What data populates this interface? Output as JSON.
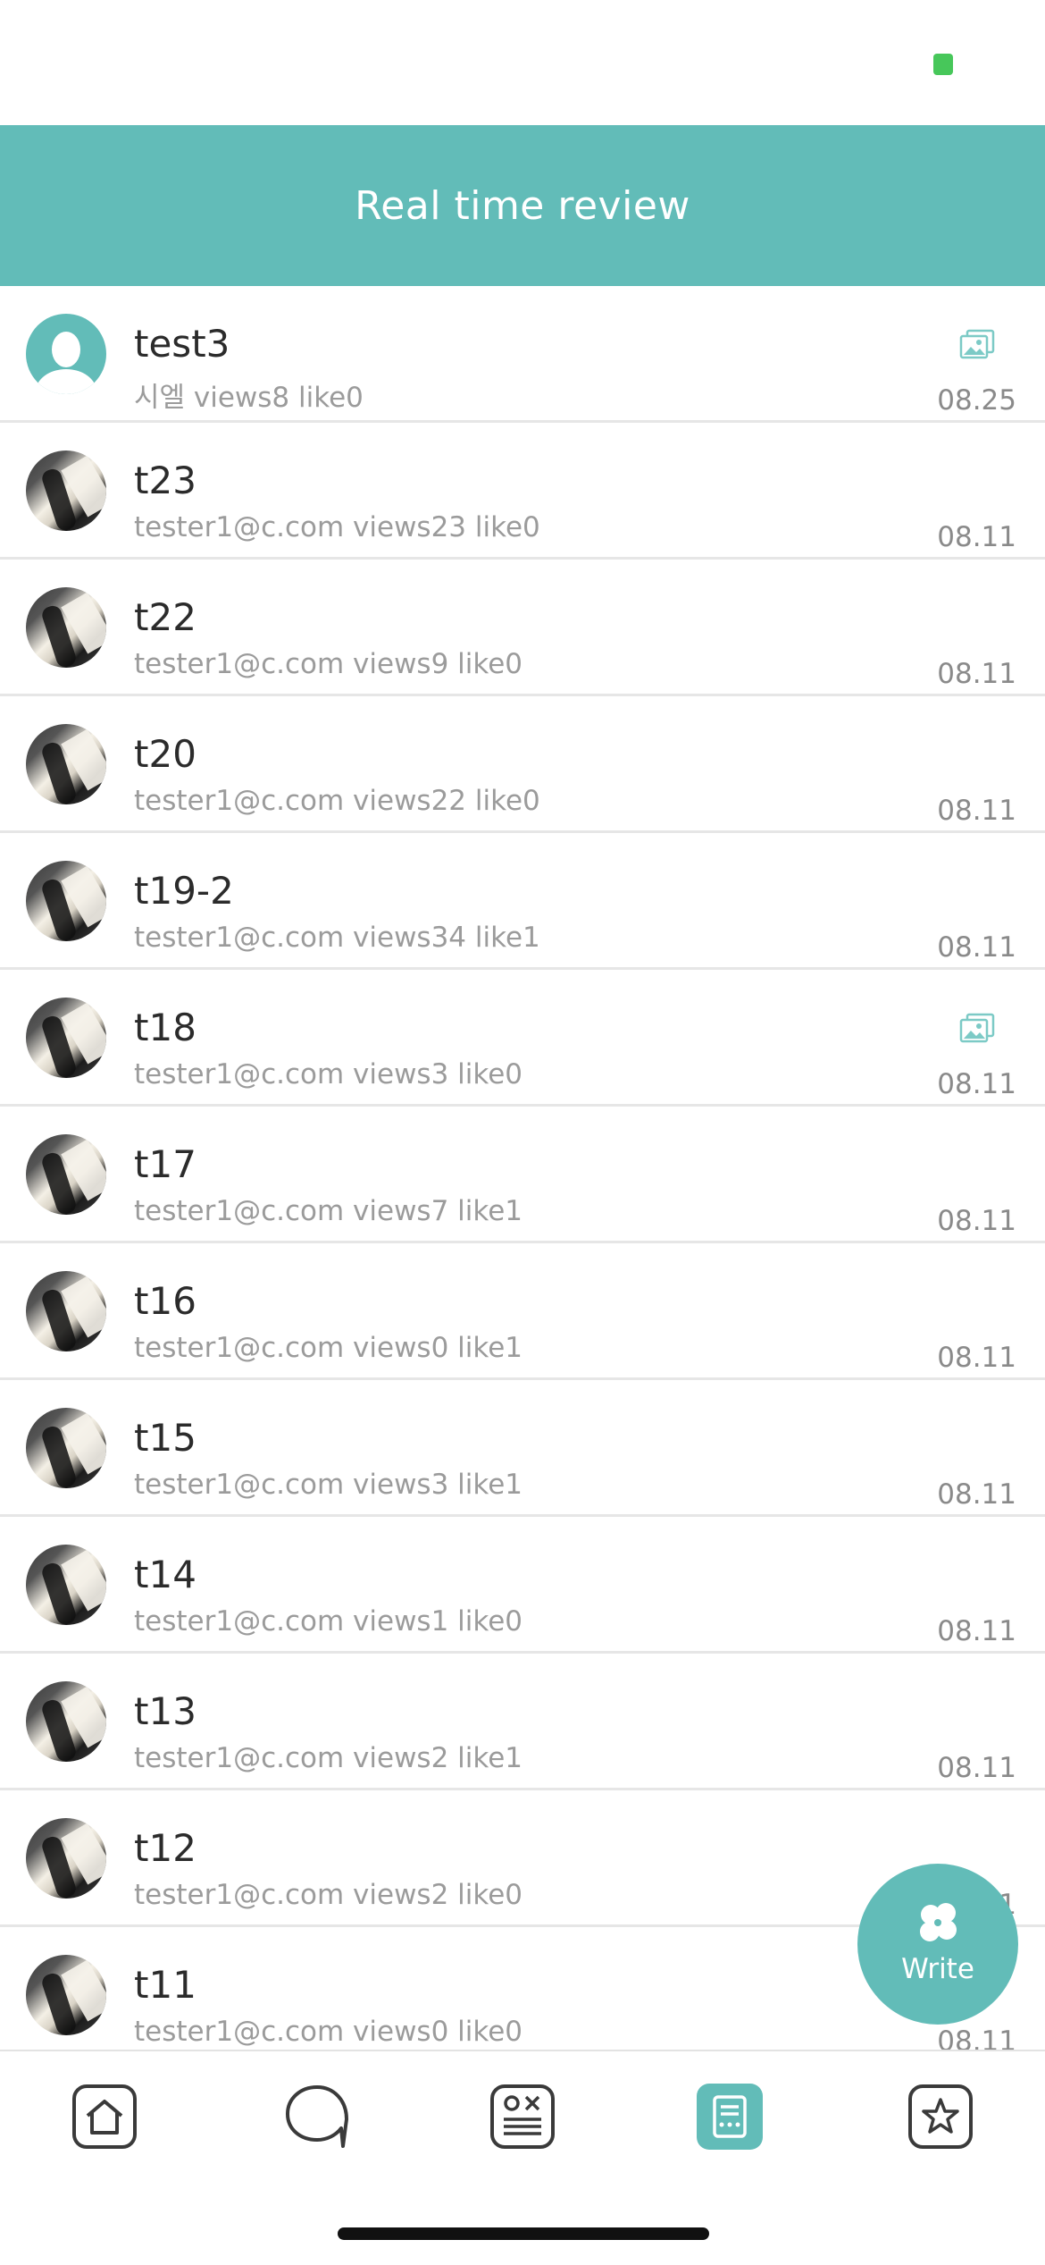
{
  "header": {
    "title": "Real time review"
  },
  "reviews": [
    {
      "title": "test3",
      "meta": "시엘 views8 like0",
      "date": "08.25",
      "avatar": "default-avatar",
      "has_image": true
    },
    {
      "title": "t23",
      "meta": "tester1@c.com views23 like0",
      "date": "08.11",
      "avatar": "photo-avatar",
      "has_image": false
    },
    {
      "title": "t22",
      "meta": "tester1@c.com views9 like0",
      "date": "08.11",
      "avatar": "photo-avatar",
      "has_image": false
    },
    {
      "title": "t20",
      "meta": "tester1@c.com views22 like0",
      "date": "08.11",
      "avatar": "photo-avatar",
      "has_image": false
    },
    {
      "title": "t19-2",
      "meta": "tester1@c.com views34 like1",
      "date": "08.11",
      "avatar": "photo-avatar",
      "has_image": false
    },
    {
      "title": "t18",
      "meta": "tester1@c.com views3 like0",
      "date": "08.11",
      "avatar": "photo-avatar",
      "has_image": true
    },
    {
      "title": "t17",
      "meta": "tester1@c.com views7 like1",
      "date": "08.11",
      "avatar": "photo-avatar",
      "has_image": false
    },
    {
      "title": "t16",
      "meta": "tester1@c.com views0 like1",
      "date": "08.11",
      "avatar": "photo-avatar",
      "has_image": false
    },
    {
      "title": "t15",
      "meta": "tester1@c.com views3 like1",
      "date": "08.11",
      "avatar": "photo-avatar",
      "has_image": false
    },
    {
      "title": "t14",
      "meta": "tester1@c.com views1 like0",
      "date": "08.11",
      "avatar": "photo-avatar",
      "has_image": false
    },
    {
      "title": "t13",
      "meta": "tester1@c.com views2 like1",
      "date": "08.11",
      "avatar": "photo-avatar",
      "has_image": false
    },
    {
      "title": "t12",
      "meta": "tester1@c.com views2 like0",
      "date": "08.11",
      "avatar": "photo-avatar",
      "has_image": false
    },
    {
      "title": "t11",
      "meta": "tester1@c.com views0 like0",
      "date": "08.11",
      "avatar": "photo-avatar",
      "has_image": false
    }
  ],
  "fab": {
    "label": "Write",
    "icon": "clover-icon"
  },
  "tabs": [
    {
      "name": "home",
      "icon": "home-icon",
      "active": false
    },
    {
      "name": "chat",
      "icon": "chat-bubble-icon",
      "active": false
    },
    {
      "name": "quiz",
      "icon": "quiz-icon",
      "active": false
    },
    {
      "name": "review",
      "icon": "review-list-icon",
      "active": true
    },
    {
      "name": "favorite",
      "icon": "star-icon",
      "active": false
    }
  ],
  "colors": {
    "accent": "#62bcb8",
    "status_green": "#47c75a",
    "text_primary": "#2b2b2b",
    "text_secondary": "#9b9b9b"
  }
}
